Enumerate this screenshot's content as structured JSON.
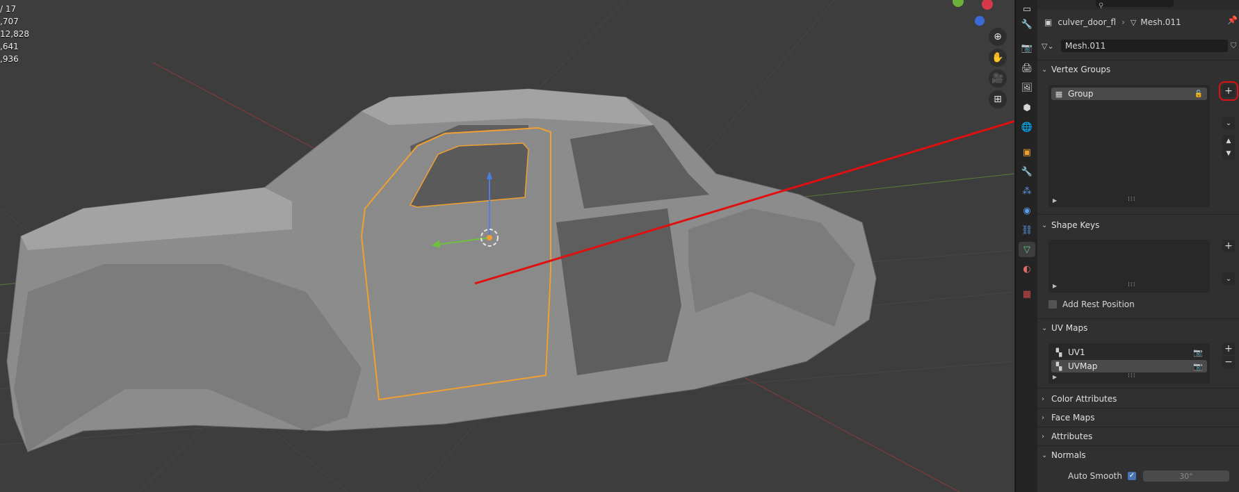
{
  "viewport": {
    "stats": [
      " / 17",
      ",707",
      "12,828",
      ",641",
      ",936"
    ]
  },
  "header": {
    "object_name": "culver_door_fl",
    "mesh_name": "Mesh.011",
    "datablock_field": "Mesh.011"
  },
  "vertex_groups": {
    "title": "Vertex Groups",
    "items": [
      "Group"
    ]
  },
  "shape_keys": {
    "title": "Shape Keys",
    "add_rest_position": "Add Rest Position"
  },
  "uv_maps": {
    "title": "UV Maps",
    "items": [
      "UV1",
      "UVMap"
    ]
  },
  "collapsed_panels": [
    "Color Attributes",
    "Face Maps",
    "Attributes"
  ],
  "normals": {
    "title": "Normals",
    "auto_smooth_label": "Auto Smooth",
    "auto_smooth_checked": true,
    "angle": "30°"
  },
  "colors": {
    "accent": "#4772b3",
    "selection_outline": "#f0a030",
    "annotation": "#e01010"
  }
}
